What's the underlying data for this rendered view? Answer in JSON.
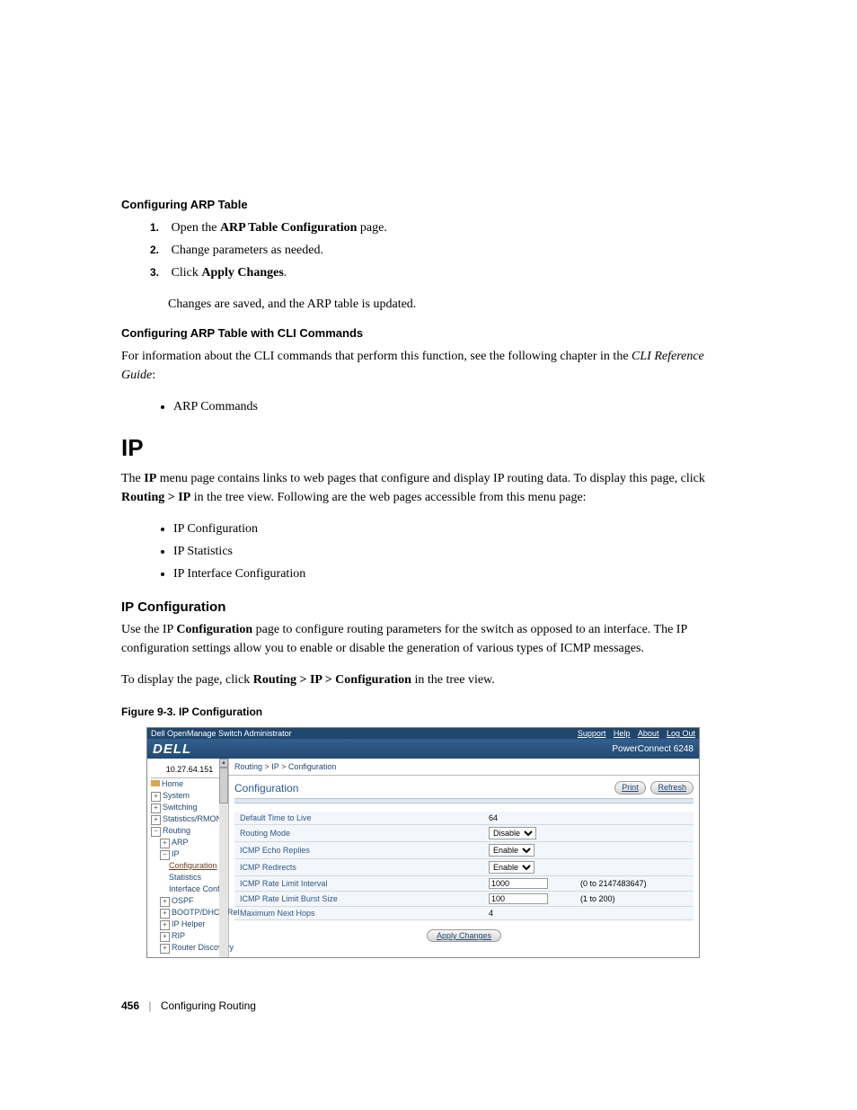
{
  "sec1_title": "Configuring ARP Table",
  "steps": {
    "s1_pre": "Open the ",
    "s1_bold": "ARP Table Configuration",
    "s1_post": " page.",
    "s2": "Change parameters as needed.",
    "s3_pre": "Click ",
    "s3_bold": "Apply Changes",
    "s3_post": ".",
    "s_after": "Changes are saved, and the ARP table is updated."
  },
  "sec2_title": "Configuring ARP Table with CLI Commands",
  "sec2_para_pre": "For information about the CLI commands that perform this function, see the following chapter in the ",
  "sec2_para_italic": "CLI Reference Guide",
  "sec2_para_post": ":",
  "sec2_bullet": "ARP Commands",
  "ip_heading": "IP",
  "ip_para_1": "The ",
  "ip_para_2_bold": "IP",
  "ip_para_3": " menu page contains links to web pages that configure and display IP routing data. To display this page, click ",
  "ip_para_4_bold": "Routing > IP",
  "ip_para_5": " in the tree view. Following are the web pages accessible from this menu page:",
  "ip_bullets": {
    "b1": "IP Configuration",
    "b2": "IP Statistics",
    "b3": "IP Interface Configuration"
  },
  "ipc_heading": "IP Configuration",
  "ipc_p1_a": "Use the IP ",
  "ipc_p1_b_bold": "Configuration",
  "ipc_p1_c": " page to configure routing parameters for the switch as opposed to an interface. The IP configuration settings allow you to enable or disable the generation of various types of ICMP messages.",
  "ipc_p2_a": "To display the page, click ",
  "ipc_p2_b_bold": "Routing > IP > Configuration",
  "ipc_p2_c": " in the tree view.",
  "fig_caption": "Figure 9-3.    IP Configuration",
  "shot": {
    "topbar_title": "Dell OpenManage Switch Administrator",
    "topbar_links": {
      "l1": "Support",
      "l2": "Help",
      "l3": "About",
      "l4": "Log Out"
    },
    "brand": "DELL",
    "device": "PowerConnect 6248",
    "tree_ip": "10.27.64.151",
    "tree": {
      "home": "Home",
      "system": "System",
      "switching": "Switching",
      "stats": "Statistics/RMON",
      "routing": "Routing",
      "arp": "ARP",
      "ip": "IP",
      "config": "Configuration",
      "statistics": "Statistics",
      "intf": "Interface Config",
      "ospf": "OSPF",
      "bootp": "BOOTP/DHCP Rel",
      "iphelper": "IP Helper",
      "rip": "RIP",
      "rdisc": "Router Discovery"
    },
    "breadcrumb": "Routing > IP > Configuration",
    "panel_title": "Configuration",
    "btn_print": "Print",
    "btn_refresh": "Refresh",
    "rows": {
      "r1_label": "Default Time to Live",
      "r1_val": "64",
      "r2_label": "Routing Mode",
      "r2_val": "Disable",
      "r3_label": "ICMP Echo Replies",
      "r3_val": "Enable",
      "r4_label": "ICMP Redirects",
      "r4_val": "Enable",
      "r5_label": "ICMP Rate Limit Interval",
      "r5_val": "1000",
      "r5_hint": "(0 to 2147483647)",
      "r6_label": "ICMP Rate Limit Burst Size",
      "r6_val": "100",
      "r6_hint": "(1 to 200)",
      "r7_label": "Maximum Next Hops",
      "r7_val": "4"
    },
    "apply": "Apply Changes"
  },
  "footer_page": "456",
  "footer_title": "Configuring Routing"
}
